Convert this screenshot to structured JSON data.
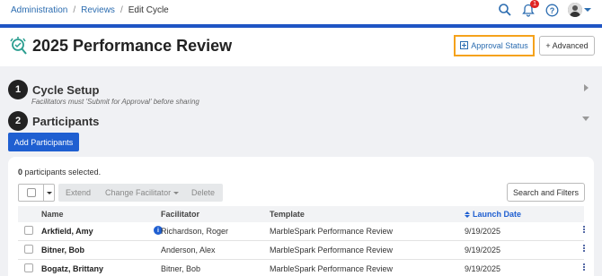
{
  "breadcrumb": {
    "items": [
      "Administration",
      "Reviews"
    ],
    "current": "Edit Cycle"
  },
  "topbar": {
    "notification_count": "1"
  },
  "header": {
    "title": "2025 Performance Review",
    "approval_status_label": "Approval Status",
    "advanced_label": "+ Advanced"
  },
  "sections": {
    "cycle_setup": {
      "number": "1",
      "title": "Cycle Setup",
      "subtitle": "Facilitators must 'Submit for Approval' before sharing"
    },
    "participants": {
      "number": "2",
      "title": "Participants",
      "add_button": "Add Participants"
    }
  },
  "participants_card": {
    "selected_count": "0",
    "selected_suffix": "participants selected.",
    "toolbar": {
      "extend": "Extend",
      "change_facilitator": "Change Facilitator",
      "delete": "Delete",
      "search_filters": "Search and Filters"
    },
    "columns": [
      "Name",
      "Facilitator",
      "Template",
      "Launch Date"
    ],
    "rows": [
      {
        "name": "Arkfield, Amy",
        "facilitator": "Richardson, Roger",
        "template": "MarbleSpark Performance Review",
        "launch_date": "9/19/2025",
        "info": "i"
      },
      {
        "name": "Bitner, Bob",
        "facilitator": "Anderson, Alex",
        "template": "MarbleSpark Performance Review",
        "launch_date": "9/19/2025"
      },
      {
        "name": "Bogatz, Brittany",
        "facilitator": "Bitner, Bob",
        "template": "MarbleSpark Performance Review",
        "launch_date": "9/19/2025"
      }
    ]
  },
  "colors": {
    "accent": "#1f5fd1",
    "highlight_border": "#f5a21b",
    "brand_strip": "#1f55c4"
  }
}
